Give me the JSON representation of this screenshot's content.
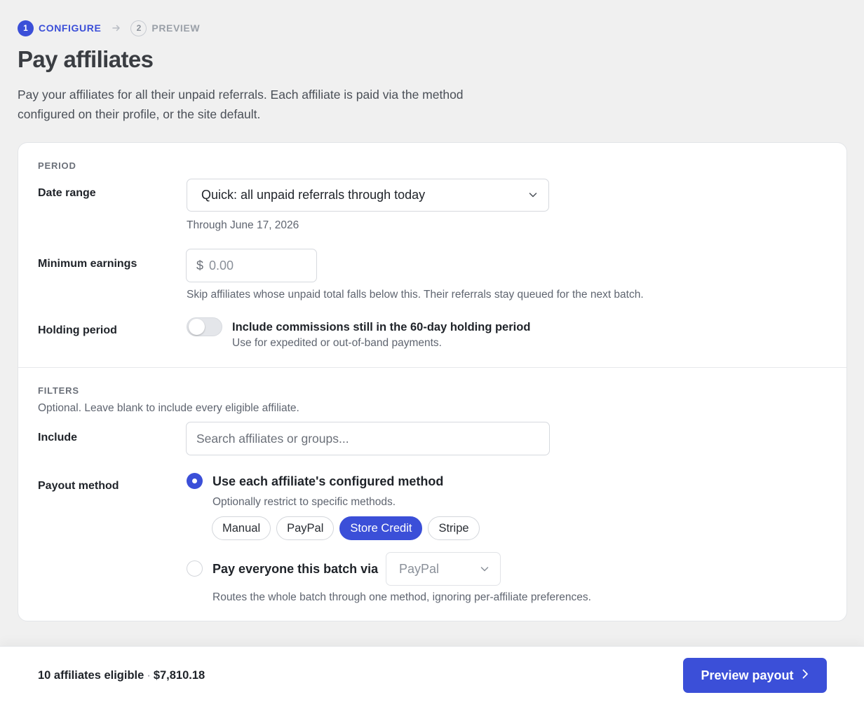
{
  "stepper": {
    "steps": [
      {
        "number": "1",
        "label": "CONFIGURE",
        "state": "active"
      },
      {
        "number": "2",
        "label": "PREVIEW",
        "state": "inactive"
      }
    ],
    "arrow_icon": "arrow-right-icon"
  },
  "header": {
    "title": "Pay affiliates",
    "description": "Pay your affiliates for all their unpaid referrals. Each affiliate is paid via the method configured on their profile, or the site default."
  },
  "period": {
    "section_label": "PERIOD",
    "date_range": {
      "label": "Date range",
      "value": "Quick: all unpaid referrals through today",
      "helper": "Through June 17, 2026"
    },
    "minimum_earnings": {
      "label": "Minimum earnings",
      "currency_symbol": "$",
      "placeholder": "0.00",
      "helper": "Skip affiliates whose unpaid total falls below this. Their referrals stay queued for the next batch."
    },
    "holding_period": {
      "label": "Holding period",
      "toggle_on": false,
      "toggle_title": "Include commissions still in the 60-day holding period",
      "toggle_sub": "Use for expedited or out-of-band payments."
    }
  },
  "filters": {
    "section_label": "FILTERS",
    "section_sub": "Optional. Leave blank to include every eligible affiliate.",
    "include": {
      "label": "Include",
      "placeholder": "Search affiliates or groups..."
    },
    "payout_method": {
      "label": "Payout method",
      "option_configured": {
        "label": "Use each affiliate's configured method",
        "sub": "Optionally restrict to specific methods.",
        "checked": true,
        "chips": [
          {
            "label": "Manual",
            "selected": false
          },
          {
            "label": "PayPal",
            "selected": false
          },
          {
            "label": "Store Credit",
            "selected": true
          },
          {
            "label": "Stripe",
            "selected": false
          }
        ]
      },
      "option_single": {
        "label": "Pay everyone this batch via",
        "select_value": "PayPal",
        "sub": "Routes the whole batch through one method, ignoring per-affiliate preferences.",
        "checked": false
      }
    }
  },
  "footer": {
    "eligible_count": "10 affiliates eligible",
    "separator": "·",
    "total": "$7,810.18",
    "primary_button": "Preview payout"
  },
  "colors": {
    "accent": "#3b4fd8",
    "background": "#f0f0f0",
    "card": "#ffffff"
  }
}
